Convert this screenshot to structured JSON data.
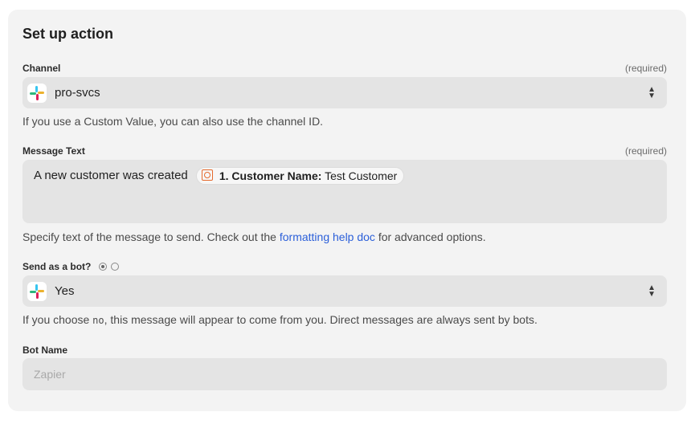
{
  "header": {
    "title": "Set up action"
  },
  "channel": {
    "label": "Channel",
    "required": "(required)",
    "value": "pro-svcs",
    "help": "If you use a Custom Value, you can also use the channel ID."
  },
  "message": {
    "label": "Message Text",
    "required": "(required)",
    "text_prefix": "A new customer was created",
    "pill_key": "1. Customer Name:",
    "pill_value": "Test Customer",
    "help_prefix": "Specify text of the message to send. Check out the ",
    "help_link": "formatting help doc",
    "help_suffix": " for advanced options."
  },
  "bot": {
    "label": "Send as a bot?",
    "value": "Yes",
    "help_prefix": "If you choose ",
    "help_code": "no",
    "help_suffix": ", this message will appear to come from you. Direct messages are always sent by bots."
  },
  "bot_name": {
    "label": "Bot Name",
    "placeholder": "Zapier"
  },
  "icons": {
    "app": "slack-icon",
    "select": "updown-arrows-icon",
    "field": "zapier-field-icon"
  },
  "colors": {
    "card_bg": "#f3f3f3",
    "field_bg": "#e4e4e4",
    "link": "#2b5fd9"
  }
}
